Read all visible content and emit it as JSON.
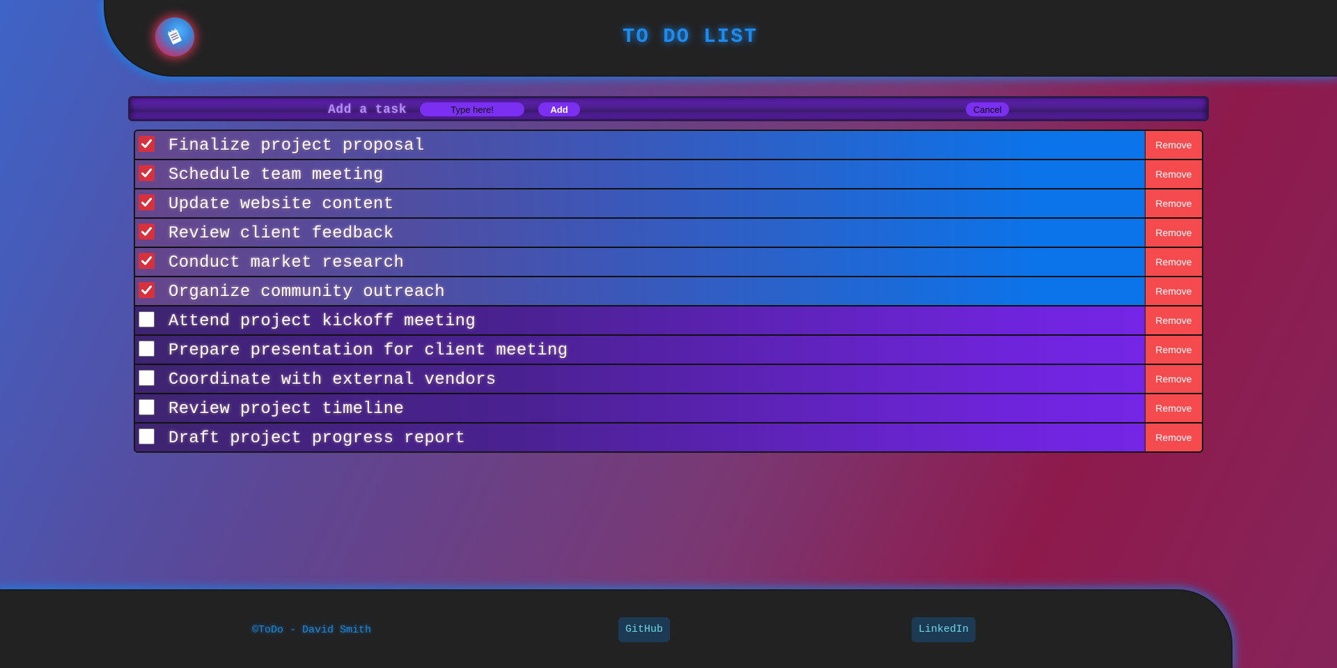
{
  "header": {
    "title": "TO DO LIST",
    "logo_icon": "notepad-icon"
  },
  "add_task": {
    "label": "Add a task",
    "input_placeholder": "Type here!",
    "input_value": "",
    "add_label": "Add",
    "cancel_label": "Cancel"
  },
  "tasks": [
    {
      "text": "Finalize project proposal",
      "done": true,
      "remove_label": "Remove"
    },
    {
      "text": "Schedule team meeting",
      "done": true,
      "remove_label": "Remove"
    },
    {
      "text": "Update website content",
      "done": true,
      "remove_label": "Remove"
    },
    {
      "text": "Review client feedback",
      "done": true,
      "remove_label": "Remove"
    },
    {
      "text": "Conduct market research",
      "done": true,
      "remove_label": "Remove"
    },
    {
      "text": "Organize community outreach",
      "done": true,
      "remove_label": "Remove"
    },
    {
      "text": "Attend project kickoff meeting",
      "done": false,
      "remove_label": "Remove"
    },
    {
      "text": "Prepare presentation for client meeting",
      "done": false,
      "remove_label": "Remove"
    },
    {
      "text": "Coordinate with external vendors",
      "done": false,
      "remove_label": "Remove"
    },
    {
      "text": "Review project timeline",
      "done": false,
      "remove_label": "Remove"
    },
    {
      "text": "Draft project progress report",
      "done": false,
      "remove_label": "Remove"
    }
  ],
  "footer": {
    "copyright": "©ToDo - David Smith",
    "github_label": "GitHub",
    "linkedin_label": "LinkedIn"
  },
  "colors": {
    "accent_blue": "#1d8bf0",
    "done_row": "#0b74ea",
    "todo_row": "#7726ec",
    "remove_button": "#f54b4f",
    "checkbox_checked": "#d8313e",
    "panel_dark": "#222223"
  }
}
